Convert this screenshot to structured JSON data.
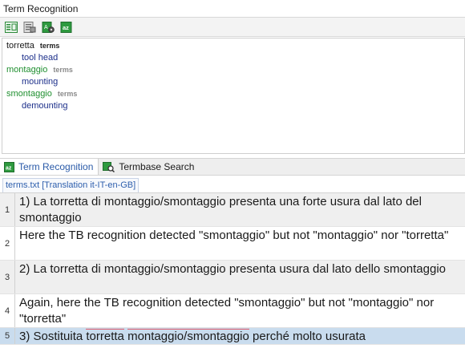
{
  "panel": {
    "title": "Term Recognition"
  },
  "toolbar": {
    "buttons": [
      {
        "name": "view-layout-button",
        "icon": "text-layout-icon"
      },
      {
        "name": "termbase-settings-button",
        "icon": "termbase-list-icon"
      },
      {
        "name": "termbase-options-button",
        "icon": "termbase-gear-icon"
      },
      {
        "name": "termbase-az-button",
        "icon": "az-book-icon"
      }
    ]
  },
  "term_recognition": {
    "entries": [
      {
        "source": "torretta",
        "source_tag": "terms",
        "target": "tool head",
        "style": "dark"
      },
      {
        "source": "montaggio",
        "source_tag": "terms",
        "target": "mounting",
        "style": "green"
      },
      {
        "source": "smontaggio",
        "source_tag": "terms",
        "target": "demounting",
        "style": "green"
      }
    ]
  },
  "tabs": [
    {
      "label": "Term Recognition",
      "active": true
    },
    {
      "label": "Termbase Search",
      "active": false
    }
  ],
  "editor": {
    "file_tab": "terms.txt [Translation it-IT-en-GB]",
    "segments": [
      {
        "num": "1",
        "text": "1) La torretta di montaggio/smontaggio presenta una forte usura dal lato del smontaggio"
      },
      {
        "num": "2",
        "text": "Here the TB recognition detected \"smontaggio\" but not \"montaggio\" nor \"torretta\""
      },
      {
        "num": "3",
        "text": "2) La torretta di montaggio/smontaggio presenta usura dal lato dello smontaggio"
      },
      {
        "num": "4",
        "text": "Again, here the TB recognition detected \"smontaggio\" but not \"montaggio\" nor \"torretta\""
      },
      {
        "num": "5",
        "text_parts": [
          "3) Sostituita ",
          "torretta",
          " ",
          "montaggio",
          "/",
          "smontaggio",
          " perché molto usurata"
        ]
      }
    ]
  },
  "colors": {
    "accent_blue": "#2a5aa8",
    "term_green": "#1f8f2f",
    "term_target": "#1c2f8a",
    "selected_row": "#c9dcee",
    "term_underline": "#e05a6a"
  }
}
